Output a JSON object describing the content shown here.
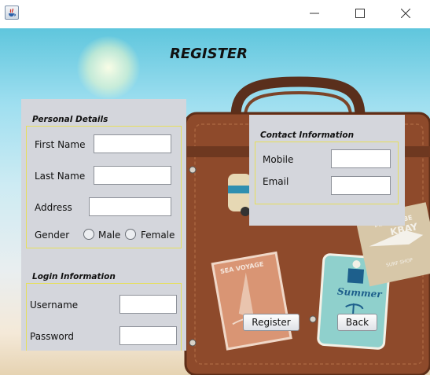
{
  "window": {
    "icons": {
      "app": "java-app-icon",
      "minimize": "minimize-icon",
      "maximize": "maximize-icon",
      "close": "close-icon"
    }
  },
  "form": {
    "title": "REGISTER"
  },
  "personal": {
    "section_title": "Personal Details",
    "first_name_label": "First Name",
    "first_name_value": "",
    "last_name_label": "Last Name",
    "last_name_value": "",
    "address_label": "Address",
    "address_value": "",
    "gender_label": "Gender",
    "gender_options": [
      "Male",
      "Female"
    ]
  },
  "contact": {
    "section_title": "Contact Information",
    "mobile_label": "Mobile",
    "mobile_value": "",
    "email_label": "Email",
    "email_value": ""
  },
  "login": {
    "section_title": "Login Information",
    "username_label": "Username",
    "username_value": "",
    "password_label": "Password",
    "password_value": ""
  },
  "actions": {
    "register_label": "Register",
    "back_label": "Back"
  },
  "background_art": {
    "sea_voyage_text": "SEA VOYAGE",
    "summer_text": "Summer",
    "malibu_text": "MALIBU BE",
    "kbay_text": "KBAY",
    "surf_shop_text": "SURF SHOP"
  },
  "colors": {
    "panel": "#d4d6dc",
    "group_border": "#e6df5c",
    "suitcase": "#8e4a2b",
    "sky": "#8fd8ea"
  }
}
